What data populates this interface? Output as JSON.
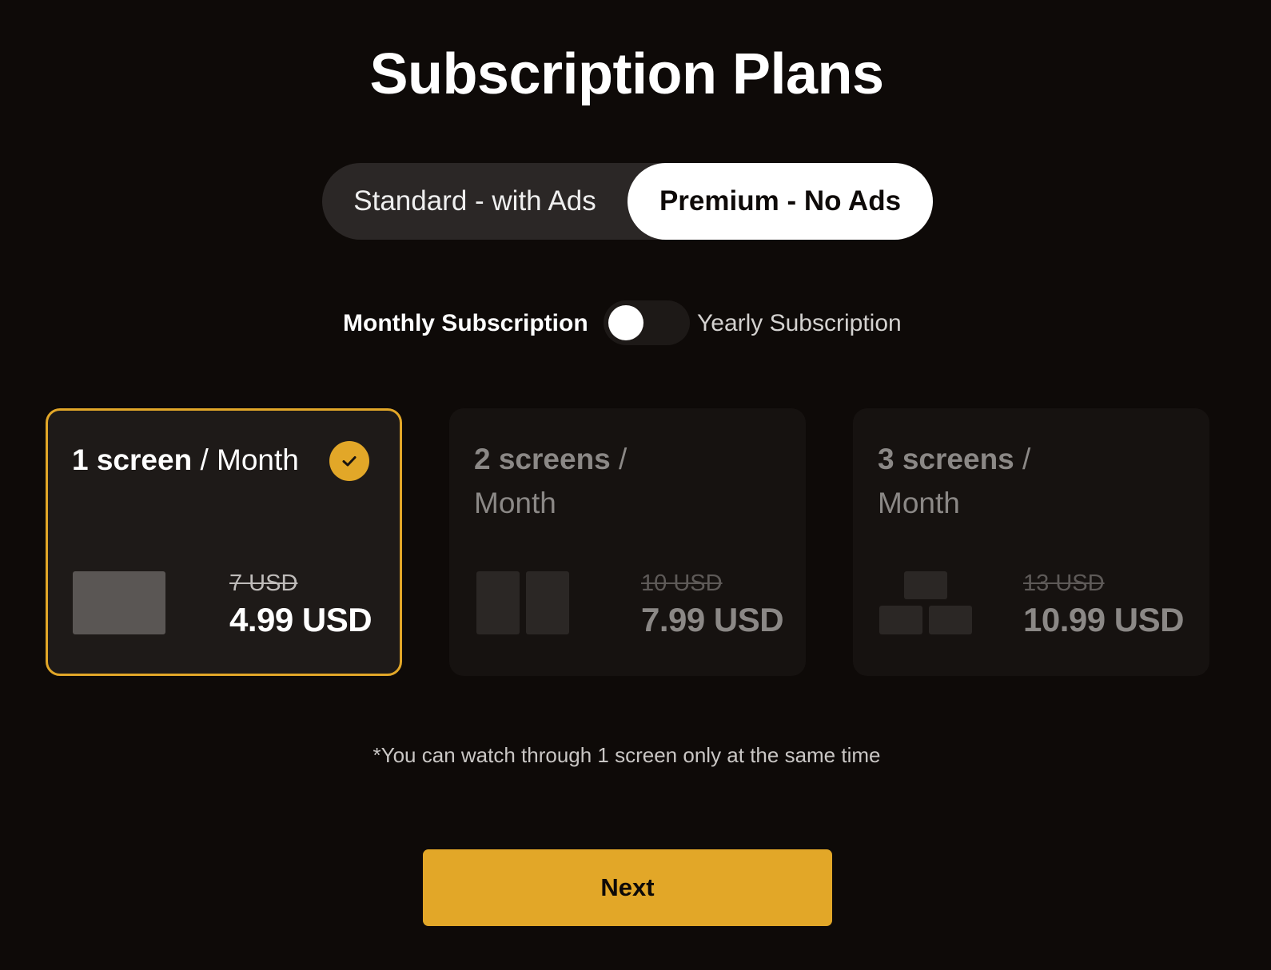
{
  "page": {
    "title": "Subscription Plans"
  },
  "plan_type": {
    "options": [
      {
        "label": "Standard - with Ads",
        "selected": false
      },
      {
        "label": "Premium - No Ads",
        "selected": true
      }
    ]
  },
  "billing": {
    "monthly_label": "Monthly Subscription",
    "yearly_label": "Yearly Subscription",
    "yearly_enabled": false
  },
  "cards": [
    {
      "count": "1 screen",
      "period": " / Month",
      "old_price": "7 USD",
      "price": "4.99 USD",
      "selected": true,
      "icon": "single-screen-icon"
    },
    {
      "count": "2 screens",
      "period": " / Month",
      "old_price": "10 USD",
      "price": "7.99 USD",
      "selected": false,
      "icon": "two-screens-icon"
    },
    {
      "count": "3 screens",
      "period": " / Month",
      "old_price": "13 USD",
      "price": "10.99 USD",
      "selected": false,
      "icon": "three-screens-icon"
    }
  ],
  "footnote": "*You can watch through 1 screen only at the same time",
  "next_label": "Next",
  "colors": {
    "background": "#0e0a08",
    "accent": "#e2a728",
    "toggle_track": "#2b2726"
  }
}
